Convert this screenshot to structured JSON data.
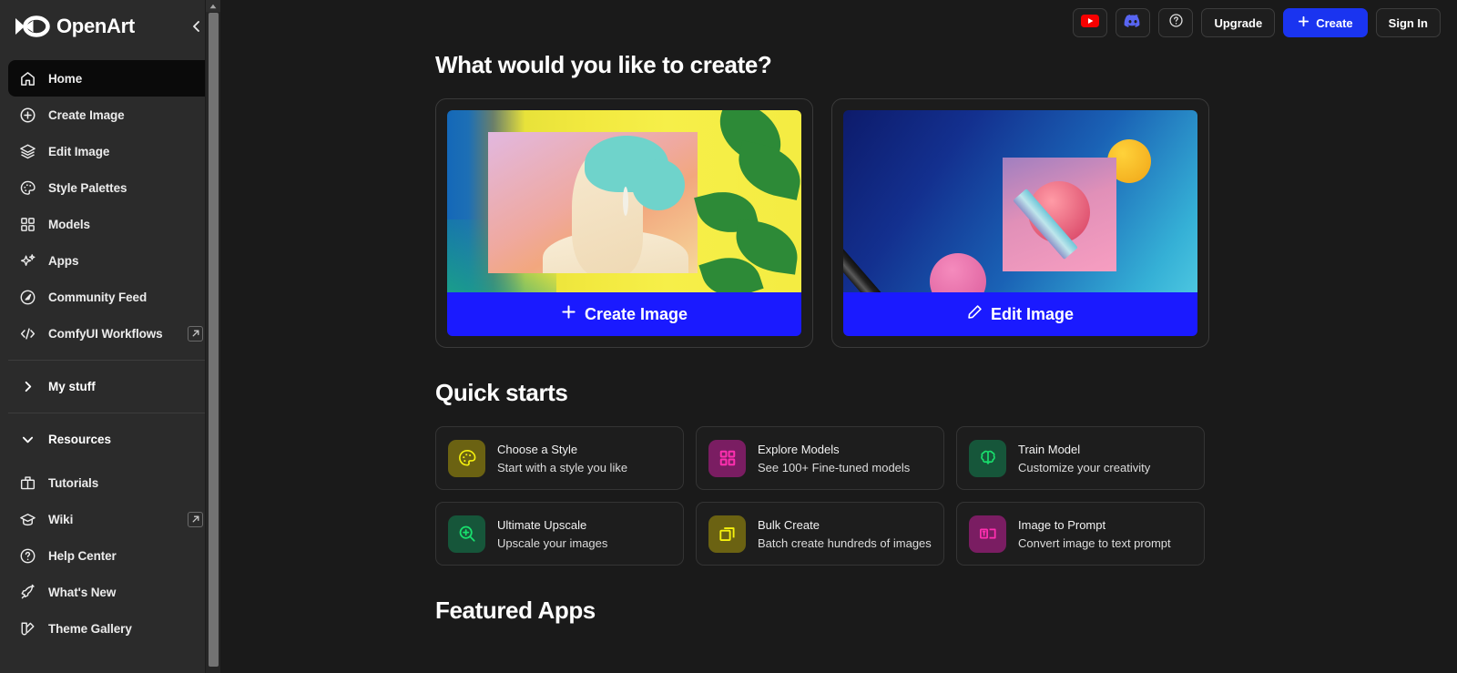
{
  "brand": {
    "name": "OpenArt",
    "logo_icon": "openart-infinity-logo",
    "collapse_icon": "chevron-left-icon"
  },
  "sidebar": {
    "nav": [
      {
        "label": "Home",
        "icon": "home-icon",
        "active": true
      },
      {
        "label": "Create Image",
        "icon": "plus-circle-icon",
        "active": false
      },
      {
        "label": "Edit Image",
        "icon": "layers-icon",
        "active": false
      },
      {
        "label": "Style Palettes",
        "icon": "palette-icon",
        "active": false
      },
      {
        "label": "Models",
        "icon": "grid-squares-icon",
        "active": false
      },
      {
        "label": "Apps",
        "icon": "sparkles-icon",
        "active": false
      },
      {
        "label": "Community Feed",
        "icon": "compass-icon",
        "active": false
      },
      {
        "label": "ComfyUI Workflows",
        "icon": "code-brackets-icon",
        "active": false,
        "external": true
      }
    ],
    "my_stuff": {
      "label": "My stuff",
      "chevron_icon": "chevron-right-icon",
      "expanded": false
    },
    "resources": {
      "label": "Resources",
      "chevron_icon": "chevron-down-icon",
      "expanded": true
    },
    "resource_items": [
      {
        "label": "Tutorials",
        "icon": "open-book-icon",
        "external": false
      },
      {
        "label": "Wiki",
        "icon": "graduation-cap-icon",
        "external": true
      },
      {
        "label": "Help Center",
        "icon": "question-circle-icon",
        "external": false
      },
      {
        "label": "What's New",
        "icon": "rocket-icon",
        "external": false
      },
      {
        "label": "Theme Gallery",
        "icon": "swatches-icon",
        "external": false
      }
    ],
    "external_icon": "external-link-icon"
  },
  "topbar": {
    "youtube": {
      "label": "",
      "icon": "youtube-icon"
    },
    "discord": {
      "label": "",
      "icon": "discord-icon"
    },
    "help": {
      "label": "",
      "icon": "question-circle-icon"
    },
    "upgrade_label": "Upgrade",
    "create_label": "Create",
    "create_icon": "plus-icon",
    "signin_label": "Sign In"
  },
  "main": {
    "heading": "What would you like to create?",
    "hero_cards": [
      {
        "cta_label": "Create Image",
        "cta_icon": "plus-icon",
        "art": "woman-portrait-yellow-leaves"
      },
      {
        "cta_label": "Edit Image",
        "cta_icon": "pencil-icon",
        "art": "pen-and-shapes-blue"
      }
    ],
    "quick_starts_heading": "Quick starts",
    "quick_starts": [
      {
        "title": "Choose a Style",
        "subtitle": "Start with a style you like",
        "icon": "palette-icon",
        "bg": "#6b6212",
        "fg": "#f5f10e"
      },
      {
        "title": "Explore Models",
        "subtitle": "See 100+ Fine-tuned models",
        "icon": "grid-squares-icon",
        "bg": "#7a1d62",
        "fg": "#ff2fb0"
      },
      {
        "title": "Train Model",
        "subtitle": "Customize your creativity",
        "icon": "brain-icon",
        "bg": "#16563a",
        "fg": "#19e06d"
      },
      {
        "title": "Ultimate Upscale",
        "subtitle": "Upscale your images",
        "icon": "zoom-in-icon",
        "bg": "#16563a",
        "fg": "#19e06d"
      },
      {
        "title": "Bulk Create",
        "subtitle": "Batch create hundreds of images",
        "icon": "copy-stack-icon",
        "bg": "#6b6212",
        "fg": "#f5f10e"
      },
      {
        "title": "Image to Prompt",
        "subtitle": "Convert image to text prompt",
        "icon": "image-to-text-icon",
        "bg": "#7a1d62",
        "fg": "#ff2fb0"
      }
    ],
    "featured_heading": "Featured Apps"
  },
  "colors": {
    "accent_blue": "#1a1aff",
    "button_blue": "#1a34f0",
    "sidebar_bg": "#2b2b2b",
    "main_bg": "#1a1a1a",
    "active_item_bg": "#0a0a0a"
  }
}
